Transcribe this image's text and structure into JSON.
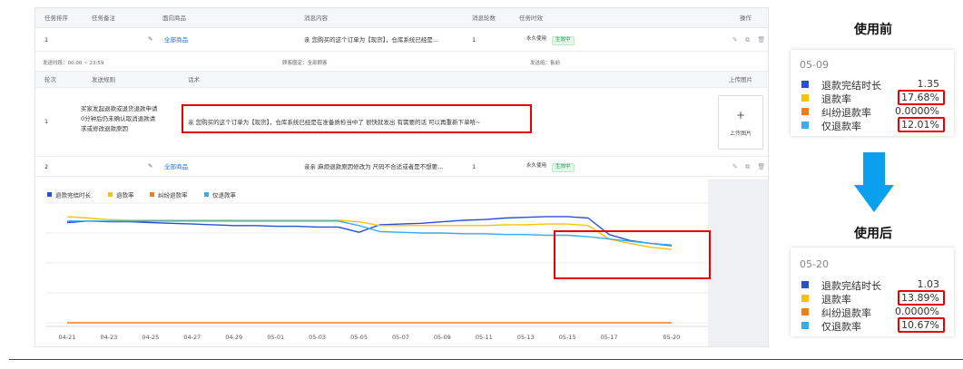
{
  "table": {
    "headers": {
      "task_order": "任务排序",
      "task_note": "任务备注",
      "target_goods": "面向商品",
      "message_content": "消息内容",
      "message_rounds": "消息轮数",
      "task_validity": "任务时效",
      "operations": "操作"
    },
    "rows": [
      {
        "order": "1",
        "goods": "全部商品",
        "message": "亲 您购买的这个订单为【现货】，仓库系统已经是...",
        "rounds": "1",
        "validity": "永久使用",
        "status": "生效中"
      },
      {
        "order": "2",
        "goods": "全部商品",
        "message": "亲亲 麻烦退款原因修改为 尺码不合适或者是不想要...",
        "rounds": "1",
        "validity": "永久使用",
        "status": "生效中"
      }
    ],
    "detail": {
      "send_time": "发送时段：00:00 ~ 23:59",
      "customer_scope": "顾客圈定：全部顾客",
      "send_group": "发送组：售前",
      "col_round": "轮次",
      "col_rule": "发送规则",
      "col_script": "话术",
      "col_upload": "上传图片",
      "round": "1",
      "rule_lines": [
        "买家发起退款或退货退款申请",
        "0分钟后仍未确认取消退款请",
        "求或修改退款原因"
      ],
      "script": "亲 您购买的这个订单为【现货】，仓库系统已经是在准备质检当中了 很快就发出 有需要的话 可以再重新下单哈~",
      "upload_plus": "+",
      "upload_label": "上传图片"
    }
  },
  "colors": {
    "series_duration": "#2a4fd6",
    "series_refund_rate": "#f5c400",
    "series_dispute_rate": "#f07c1a",
    "series_only_refund_rate": "#34aef0",
    "highlight_red": "#e60000",
    "arrow_blue": "#0aa0ee"
  },
  "chart_data": {
    "type": "line",
    "legend_position": "top-left",
    "grid": "horizontal",
    "categories": [
      "04-21",
      "04-22",
      "04-23",
      "04-24",
      "04-25",
      "04-26",
      "04-27",
      "04-28",
      "04-29",
      "04-30",
      "05-01",
      "05-02",
      "05-03",
      "05-04",
      "05-05",
      "05-06",
      "05-07",
      "05-08",
      "05-09",
      "05-10",
      "05-11",
      "05-12",
      "05-13",
      "05-14",
      "05-15",
      "05-16",
      "05-17",
      "05-18",
      "05-19",
      "05-20"
    ],
    "x_tick_labels": [
      "04-21",
      "04-23",
      "04-25",
      "04-27",
      "04-29",
      "05-01",
      "05-03",
      "05-05",
      "05-07",
      "05-09",
      "05-11",
      "05-13",
      "05-15",
      "05-17",
      "05-20"
    ],
    "series": [
      {
        "name": "退款完结时长",
        "values": [
          1.34,
          1.36,
          1.35,
          1.35,
          1.34,
          1.33,
          1.32,
          1.31,
          1.3,
          1.3,
          1.29,
          1.29,
          1.28,
          1.28,
          1.21,
          1.31,
          1.32,
          1.33,
          1.35,
          1.37,
          1.38,
          1.4,
          1.41,
          1.42,
          1.42,
          1.4,
          1.18,
          1.1,
          1.06,
          1.03
        ]
      },
      {
        "name": "退款率",
        "values": [
          1.42,
          1.4,
          1.38,
          1.37,
          1.37,
          1.37,
          1.37,
          1.37,
          1.37,
          1.37,
          1.37,
          1.37,
          1.37,
          1.37,
          1.35,
          1.3,
          1.3,
          1.3,
          1.3,
          1.3,
          1.3,
          1.31,
          1.31,
          1.32,
          1.32,
          1.3,
          1.12,
          1.06,
          1.01,
          0.98
        ]
      },
      {
        "name": "纠纷退款率",
        "values": [
          0,
          0,
          0,
          0,
          0,
          0,
          0,
          0,
          0,
          0,
          0,
          0,
          0,
          0,
          0,
          0,
          0,
          0,
          0,
          0,
          0,
          0,
          0,
          0,
          0,
          0,
          0,
          0,
          0,
          0
        ]
      },
      {
        "name": "仅退款率",
        "values": [
          1.36,
          1.36,
          1.36,
          1.36,
          1.36,
          1.36,
          1.36,
          1.36,
          1.36,
          1.36,
          1.36,
          1.36,
          1.36,
          1.36,
          1.3,
          1.22,
          1.21,
          1.2,
          1.2,
          1.19,
          1.19,
          1.18,
          1.18,
          1.17,
          1.17,
          1.15,
          1.12,
          1.09,
          1.06,
          1.04
        ]
      }
    ],
    "ylim": [
      0,
      1.6
    ]
  },
  "panels": {
    "before": {
      "title": "使用前",
      "date": "05-09",
      "items": [
        {
          "label": "退款完结时长",
          "value": "1.35",
          "highlight": false
        },
        {
          "label": "退款率",
          "value": "17.68%",
          "highlight": true
        },
        {
          "label": "纠纷退款率",
          "value": "0.0000%",
          "highlight": false
        },
        {
          "label": "仅退款率",
          "value": "12.01%",
          "highlight": true
        }
      ]
    },
    "after": {
      "title": "使用后",
      "date": "05-20",
      "items": [
        {
          "label": "退款完结时长",
          "value": "1.03",
          "highlight": false
        },
        {
          "label": "退款率",
          "value": "13.89%",
          "highlight": true
        },
        {
          "label": "纠纷退款率",
          "value": "0.0000%",
          "highlight": false
        },
        {
          "label": "仅退款率",
          "value": "10.67%",
          "highlight": true
        }
      ]
    }
  },
  "icons": {
    "edit": "✎",
    "ops": "✎ ⧉ 🗑"
  }
}
